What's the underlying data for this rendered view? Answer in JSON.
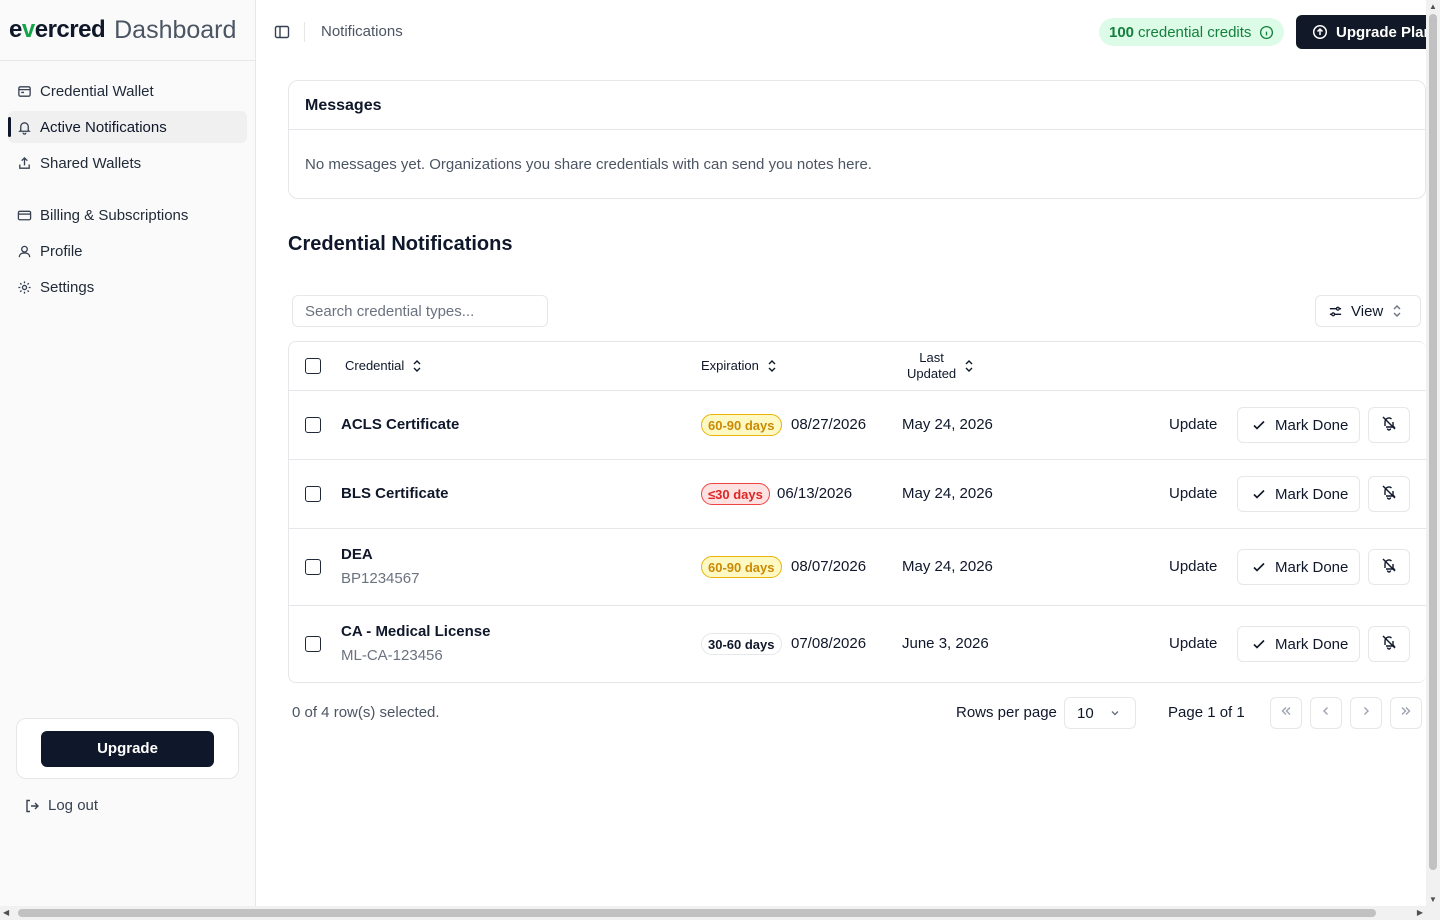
{
  "brand": {
    "logo_pre": "e",
    "logo_v": "v",
    "logo_post": "ercred",
    "title": "Dashboard"
  },
  "sidebar": {
    "items": [
      {
        "label": "Credential Wallet",
        "icon": "wallet-icon"
      },
      {
        "label": "Active Notifications",
        "icon": "bell-icon",
        "active": true
      },
      {
        "label": "Shared Wallets",
        "icon": "share-icon"
      },
      {
        "label": "Billing & Subscriptions",
        "icon": "credit-card-icon"
      },
      {
        "label": "Profile",
        "icon": "user-icon"
      },
      {
        "label": "Settings",
        "icon": "gear-icon"
      }
    ],
    "upgrade_label": "Upgrade",
    "logout_label": "Log out"
  },
  "header": {
    "breadcrumb": "Notifications",
    "credits_count": "100",
    "credits_label": "credential credits",
    "upgrade_plan_label": "Upgrade Plan"
  },
  "messages": {
    "title": "Messages",
    "empty_text": "No messages yet. Organizations you share credentials with can send you notes here."
  },
  "notifications": {
    "title": "Credential Notifications",
    "search_placeholder": "Search credential types...",
    "view_label": "View",
    "columns": {
      "credential": "Credential",
      "expiration": "Expiration",
      "last_updated_1": "Last",
      "last_updated_2": "Updated"
    },
    "rows": [
      {
        "name": "ACLS Certificate",
        "sub": "",
        "badge": "60-90 days",
        "badge_style": "yellow",
        "expiration": "08/27/2026",
        "updated": "May 24, 2026"
      },
      {
        "name": "BLS Certificate",
        "sub": "",
        "badge": "≤30 days",
        "badge_style": "red",
        "expiration": "06/13/2026",
        "updated": "May 24, 2026"
      },
      {
        "name": "DEA",
        "sub": "BP1234567",
        "badge": "60-90 days",
        "badge_style": "yellow",
        "expiration": "08/07/2026",
        "updated": "May 24, 2026"
      },
      {
        "name": "CA - Medical License",
        "sub": "ML-CA-123456",
        "badge": "30-60 days",
        "badge_style": "plain",
        "expiration": "07/08/2026",
        "updated": "June 3, 2026"
      }
    ],
    "row_actions": {
      "update": "Update",
      "mark_done": "Mark Done"
    },
    "footer": {
      "selected_text": "0 of 4 row(s) selected.",
      "rows_per_page_label": "Rows per page",
      "rows_per_page_value": "10",
      "page_info": "Page 1 of 1"
    }
  },
  "colors": {
    "accent_green": "#16a34a",
    "dark": "#0f172a",
    "badge_yellow": "#ca8a04",
    "badge_red": "#dc2626"
  }
}
